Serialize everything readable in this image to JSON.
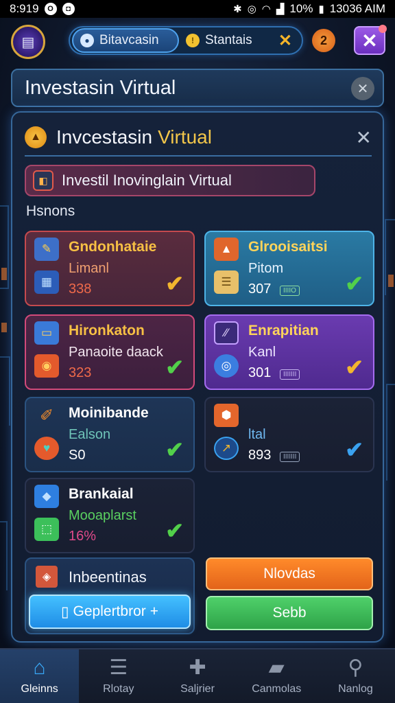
{
  "status_bar": {
    "time": "8:919",
    "battery": "10%",
    "clock": "13036 AIM"
  },
  "app_bar": {
    "segment_active": "Bitavcasin",
    "segment_inactive": "Stantais",
    "notification_count": "2"
  },
  "title_bar": {
    "title": "Investasin Virtual"
  },
  "modal": {
    "title_part1": "Invcestasin",
    "title_part2": "Virtual",
    "banner_text": "Investil Inovinglain Virtual",
    "section_label": "Hsnons"
  },
  "cards": [
    {
      "name": "Gndonhataie",
      "sub": "Limanl",
      "value": "338",
      "tag": "",
      "checked": true
    },
    {
      "name": "Glrooisaitsi",
      "sub": "Pitom",
      "value": "307",
      "tag": "IIIIO",
      "checked": true
    },
    {
      "name": "Hironkaton",
      "sub": "Panaoite daack",
      "value": "323",
      "tag": "",
      "checked": true
    },
    {
      "name": "Enrapitian",
      "sub": "Kanl",
      "value": "301",
      "tag": "IIIIIII",
      "checked": true
    },
    {
      "name": "Moinibande",
      "sub": "Ealson",
      "value": "S0",
      "tag": "",
      "checked": true
    },
    {
      "name": "",
      "sub": "ltal",
      "value": "893",
      "tag": "IIIIIII",
      "checked": true
    },
    {
      "name": "Brankaial",
      "sub": "Mooaplarst",
      "value": "16%",
      "tag": "",
      "checked": true
    }
  ],
  "bottom_panel": {
    "title": "Inbeentinas",
    "primary_button": "Geplertbror"
  },
  "buttons": {
    "orange": "Nlovdas",
    "green": "Sebb"
  },
  "bottom_nav": [
    {
      "label": "Gleinns",
      "icon": "home-icon",
      "active": true
    },
    {
      "label": "Rlotay",
      "icon": "list-icon",
      "active": false
    },
    {
      "label": "Saljrier",
      "icon": "cross-icon",
      "active": false
    },
    {
      "label": "Canmolas",
      "icon": "folder-icon",
      "active": false
    },
    {
      "label": "Nanlog",
      "icon": "search-icon",
      "active": false
    }
  ],
  "colors": {
    "accent_blue": "#39a8f6",
    "check_gold": "#f2b62e",
    "check_green": "#52d04a",
    "check_blue": "#3aa2f0",
    "title_gold": "#f2c64a"
  }
}
